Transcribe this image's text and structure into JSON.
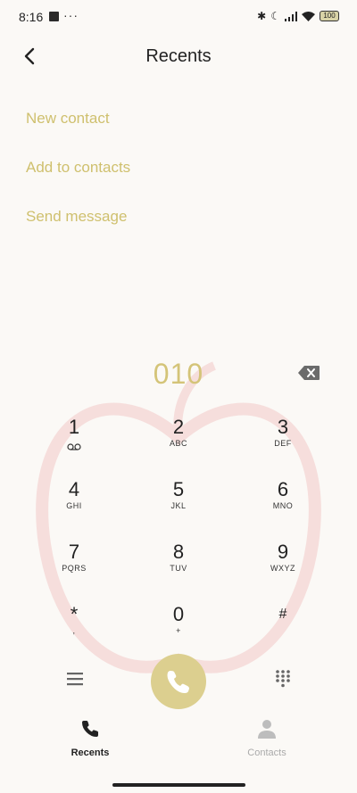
{
  "status": {
    "time": "8:16",
    "more": "···",
    "battery": "100",
    "icons": [
      "notification-square-icon",
      "bluetooth-icon",
      "moon-icon",
      "signal-icon",
      "wifi-icon",
      "battery-icon"
    ]
  },
  "header": {
    "title": "Recents"
  },
  "actions": [
    "New contact",
    "Add to contacts",
    "Send message"
  ],
  "dialer": {
    "number": "010",
    "keys": [
      {
        "digit": "1",
        "letters": ""
      },
      {
        "digit": "2",
        "letters": "ABC"
      },
      {
        "digit": "3",
        "letters": "DEF"
      },
      {
        "digit": "4",
        "letters": "GHI"
      },
      {
        "digit": "5",
        "letters": "JKL"
      },
      {
        "digit": "6",
        "letters": "MNO"
      },
      {
        "digit": "7",
        "letters": "PQRS"
      },
      {
        "digit": "8",
        "letters": "TUV"
      },
      {
        "digit": "9",
        "letters": "WXYZ"
      },
      {
        "digit": "*",
        "letters": ","
      },
      {
        "digit": "0",
        "letters": "+"
      },
      {
        "digit": "#",
        "letters": ""
      }
    ]
  },
  "nav": {
    "recents": "Recents",
    "contacts": "Contacts"
  },
  "colors": {
    "accent": "#d4c478",
    "call": "#dccf8f",
    "action_text": "#cfc06e"
  }
}
